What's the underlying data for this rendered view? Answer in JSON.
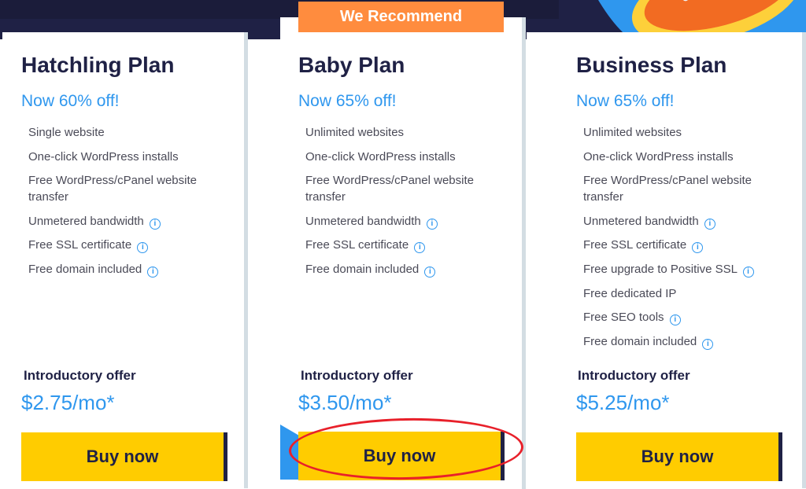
{
  "badge": "We Recommend",
  "plans": [
    {
      "title": "Hatchling Plan",
      "discount": "Now 60% off!",
      "features": [
        {
          "text": "Single website",
          "info": false
        },
        {
          "text": "One-click WordPress installs",
          "info": false
        },
        {
          "text": "Free WordPress/cPanel website transfer",
          "info": false
        },
        {
          "text": "Unmetered bandwidth",
          "info": true
        },
        {
          "text": "Free SSL certificate",
          "info": true
        },
        {
          "text": "Free domain included",
          "info": true
        }
      ],
      "intro": "Introductory offer",
      "price": "$2.75/mo*",
      "button": "Buy now"
    },
    {
      "title": "Baby Plan",
      "discount": "Now 65% off!",
      "features": [
        {
          "text": "Unlimited websites",
          "info": false
        },
        {
          "text": "One-click WordPress installs",
          "info": false
        },
        {
          "text": "Free WordPress/cPanel website transfer",
          "info": false
        },
        {
          "text": "Unmetered bandwidth",
          "info": true
        },
        {
          "text": "Free SSL certificate",
          "info": true
        },
        {
          "text": "Free domain included",
          "info": true
        }
      ],
      "intro": "Introductory offer",
      "price": "$3.50/mo*",
      "button": "Buy now",
      "recommended": true
    },
    {
      "title": "Business Plan",
      "discount": "Now 65% off!",
      "features": [
        {
          "text": "Unlimited websites",
          "info": false
        },
        {
          "text": "One-click WordPress installs",
          "info": false
        },
        {
          "text": "Free WordPress/cPanel website transfer",
          "info": false
        },
        {
          "text": "Unmetered bandwidth",
          "info": true
        },
        {
          "text": "Free SSL certificate",
          "info": true
        },
        {
          "text": "Free upgrade to Positive SSL",
          "info": true
        },
        {
          "text": "Free dedicated IP",
          "info": false
        },
        {
          "text": "Free SEO tools",
          "info": true
        },
        {
          "text": "Free domain included",
          "info": true
        }
      ],
      "intro": "Introductory offer",
      "price": "$5.25/mo*",
      "button": "Buy now"
    }
  ],
  "info_glyph": "i",
  "colors": {
    "navy": "#1f2145",
    "accent_blue": "#2f97ee",
    "badge_orange": "#ff8c3e",
    "button_yellow": "#ffcc00",
    "annotation_red": "#e8202a"
  }
}
